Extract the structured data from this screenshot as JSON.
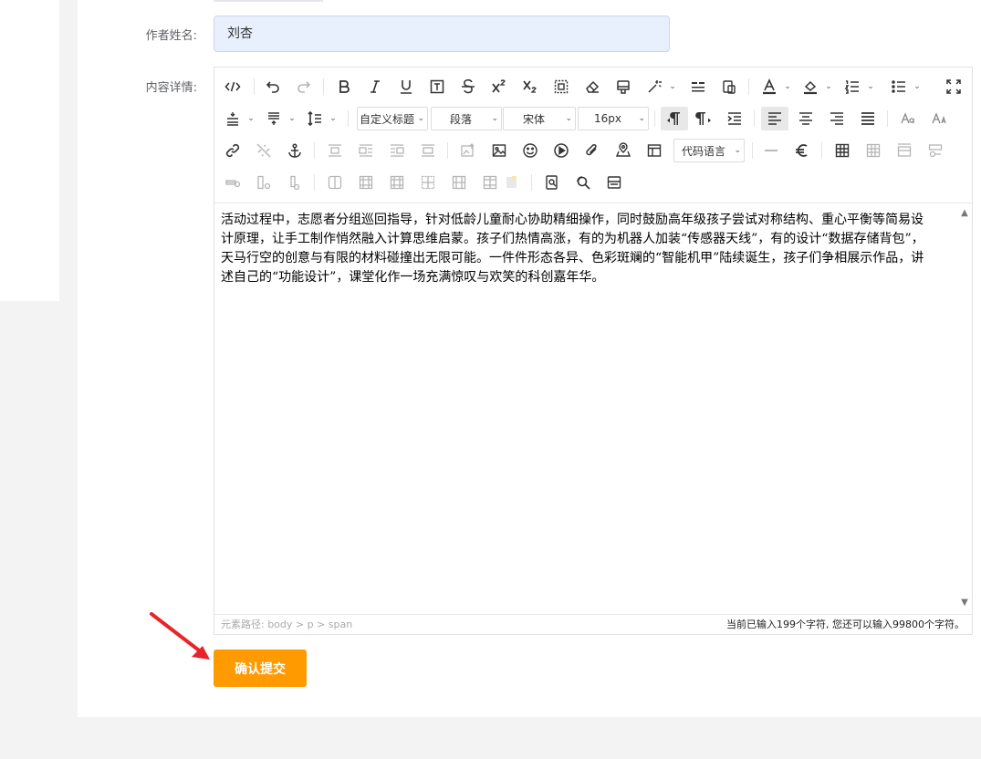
{
  "form": {
    "author_label": "作者姓名:",
    "author_value": "刘杏",
    "content_label": "内容详情:"
  },
  "editor": {
    "toolbar": {
      "custom_heading": "自定义标题",
      "paragraph": "段落",
      "font_family": "宋体",
      "font_size": "16px",
      "code_language": "代码语言"
    },
    "content_text": "活动过程中，志愿者分组巡回指导，针对低龄儿童耐心协助精细操作，同时鼓励高年级孩子尝试对称结构、重心平衡等简易设计原理，让手工制作悄然融入计算思维启蒙。孩子们热情高涨，有的为机器人加装“传感器天线”，有的设计“数据存储背包”，天马行空的创意与有限的材料碰撞出无限可能。一件件形态各异、色彩斑斓的“智能机甲”陆续诞生，孩子们争相展示作品，讲述自己的“功能设计”，课堂化作一场充满惊叹与欢笑的科创嘉年华。",
    "element_path": "元素路径: body > p > span",
    "word_count": "当前已输入199个字符, 您还可以输入99800个字符。"
  },
  "submit_label": "确认提交",
  "colors": {
    "accent": "#ff9a00",
    "input_bg": "#e8f0fd",
    "arrow": "#e8242b"
  }
}
